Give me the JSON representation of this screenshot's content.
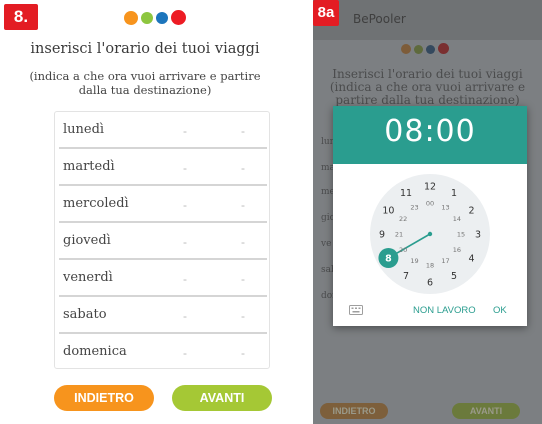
{
  "left": {
    "badge": "8.",
    "title": "inserisci l'orario dei tuoi viaggi",
    "subtitle": "(indica a che ora vuoi arrivare e partire dalla tua destinazione)",
    "days": [
      {
        "label": "lunedì",
        "arrive": "-",
        "depart": "-"
      },
      {
        "label": "martedì",
        "arrive": "-",
        "depart": "-"
      },
      {
        "label": "mercoledì",
        "arrive": "-",
        "depart": "-"
      },
      {
        "label": "giovedì",
        "arrive": "-",
        "depart": "-"
      },
      {
        "label": "venerdì",
        "arrive": "-",
        "depart": "-"
      },
      {
        "label": "sabato",
        "arrive": "-",
        "depart": "-"
      },
      {
        "label": "domenica",
        "arrive": "-",
        "depart": "-"
      }
    ],
    "back_label": "INDIETRO",
    "next_label": "AVANTI"
  },
  "right": {
    "badge": "8a",
    "app_title": "BePooler",
    "bg_title_lines": [
      "Inserisci l'orario dei tuoi viaggi",
      "(indica a che ora vuoi arrivare e",
      "partire dalla tua destinazione)"
    ],
    "bg_back_label": "INDIETRO",
    "bg_next_label": "AVANTI",
    "dialog": {
      "time": "08:00",
      "selected_hour": "8",
      "outer_hours": [
        "12",
        "1",
        "2",
        "3",
        "4",
        "5",
        "6",
        "7",
        "8",
        "9",
        "10",
        "11"
      ],
      "inner_hours": [
        "00",
        "13",
        "14",
        "15",
        "16",
        "17",
        "18",
        "19",
        "20",
        "21",
        "22",
        "23"
      ],
      "no_work_label": "NON LAVORO",
      "ok_label": "OK"
    }
  },
  "colors": {
    "badge": "#e31c23",
    "dot_orange": "#f7941d",
    "dot_green": "#8dc63f",
    "dot_blue": "#1c75bc",
    "dot_red": "#ed1c24",
    "back_button": "#f7941d",
    "next_button": "#a5c835",
    "teal": "#2a9d8f"
  }
}
